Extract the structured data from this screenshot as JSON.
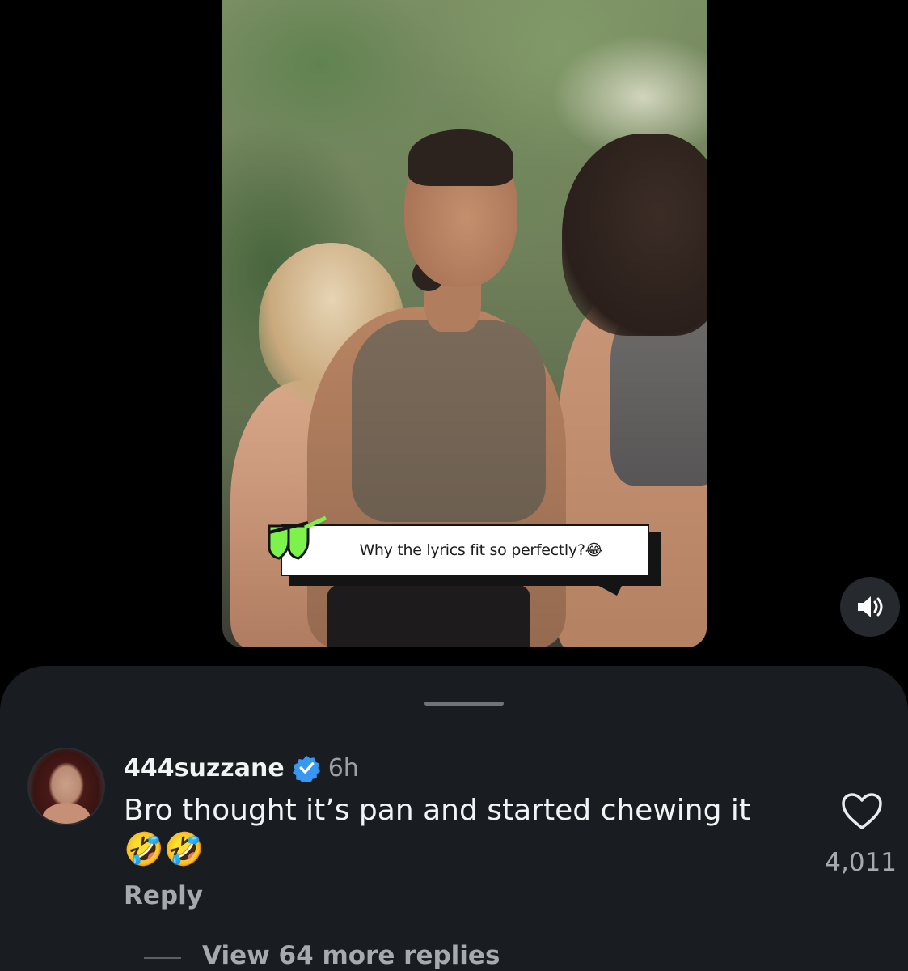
{
  "video": {
    "caption_text": "Why the lyrics fit so perfectly?😂",
    "mute_icon": "speaker-volume-icon",
    "quote_icon": "green-quote-icon",
    "accent_color": "#7cf24a"
  },
  "comment": {
    "username": "444suzzane",
    "verified_icon": "verified-badge-icon",
    "timestamp": "6h",
    "text_line1": "Bro thought it’s pan and started chewing it",
    "text_line2": "🤣🤣",
    "reply_label": "Reply",
    "like_icon": "heart-icon",
    "like_count": "4,011",
    "view_replies_label": "View 64 more replies"
  },
  "colors": {
    "background": "#000000",
    "sheet": "#191d21",
    "primary_text": "#f2f3f5",
    "secondary_text": "#a5aab0",
    "verified_blue": "#3897f0"
  }
}
